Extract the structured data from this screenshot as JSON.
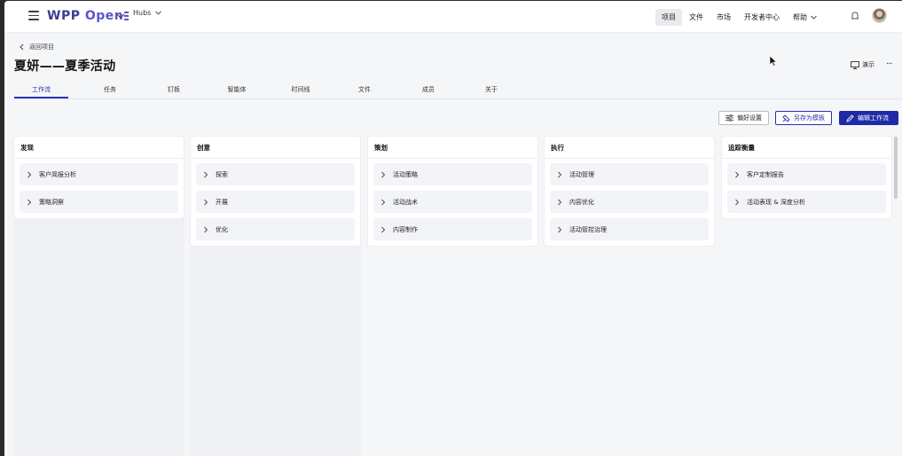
{
  "header": {
    "logo_text": "WPP",
    "logo_open": "Open",
    "hubs_label": "Hubs",
    "nav": [
      {
        "label": "项目",
        "active": true
      },
      {
        "label": "文件",
        "active": false
      },
      {
        "label": "市场",
        "active": false
      },
      {
        "label": "开发者中心",
        "active": false
      },
      {
        "label": "帮助",
        "active": false
      }
    ]
  },
  "project": {
    "back_label": "返回项目",
    "title": "夏妍——夏季活动",
    "present_label": "演示",
    "more_label": "···"
  },
  "tabs": [
    "工作流",
    "任务",
    "钉板",
    "智能体",
    "时间线",
    "文件",
    "成员",
    "关于"
  ],
  "active_tab": "工作流",
  "toolbar": {
    "preferences_label": "偏好设置",
    "save_template_label": "另存为模板",
    "edit_workflow_label": "编辑工作流"
  },
  "columns": [
    {
      "title": "发现",
      "items": [
        "客户简报分析",
        "策略洞察"
      ]
    },
    {
      "title": "创意",
      "items": [
        "探索",
        "开展",
        "优化"
      ]
    },
    {
      "title": "策划",
      "items": [
        "活动策略",
        "活动战术",
        "内容制作"
      ]
    },
    {
      "title": "执行",
      "items": [
        "活动管理",
        "内容优化",
        "活动管控治理"
      ]
    },
    {
      "title": "追踪衡量",
      "items": [
        "客户定制报告",
        "活动表现 & 深度分析"
      ]
    }
  ],
  "colors": {
    "accent": "#1f2aa8",
    "accent_text": "#2a2fb5",
    "background": "#f5f6f8",
    "card": "#f3f4f7"
  }
}
